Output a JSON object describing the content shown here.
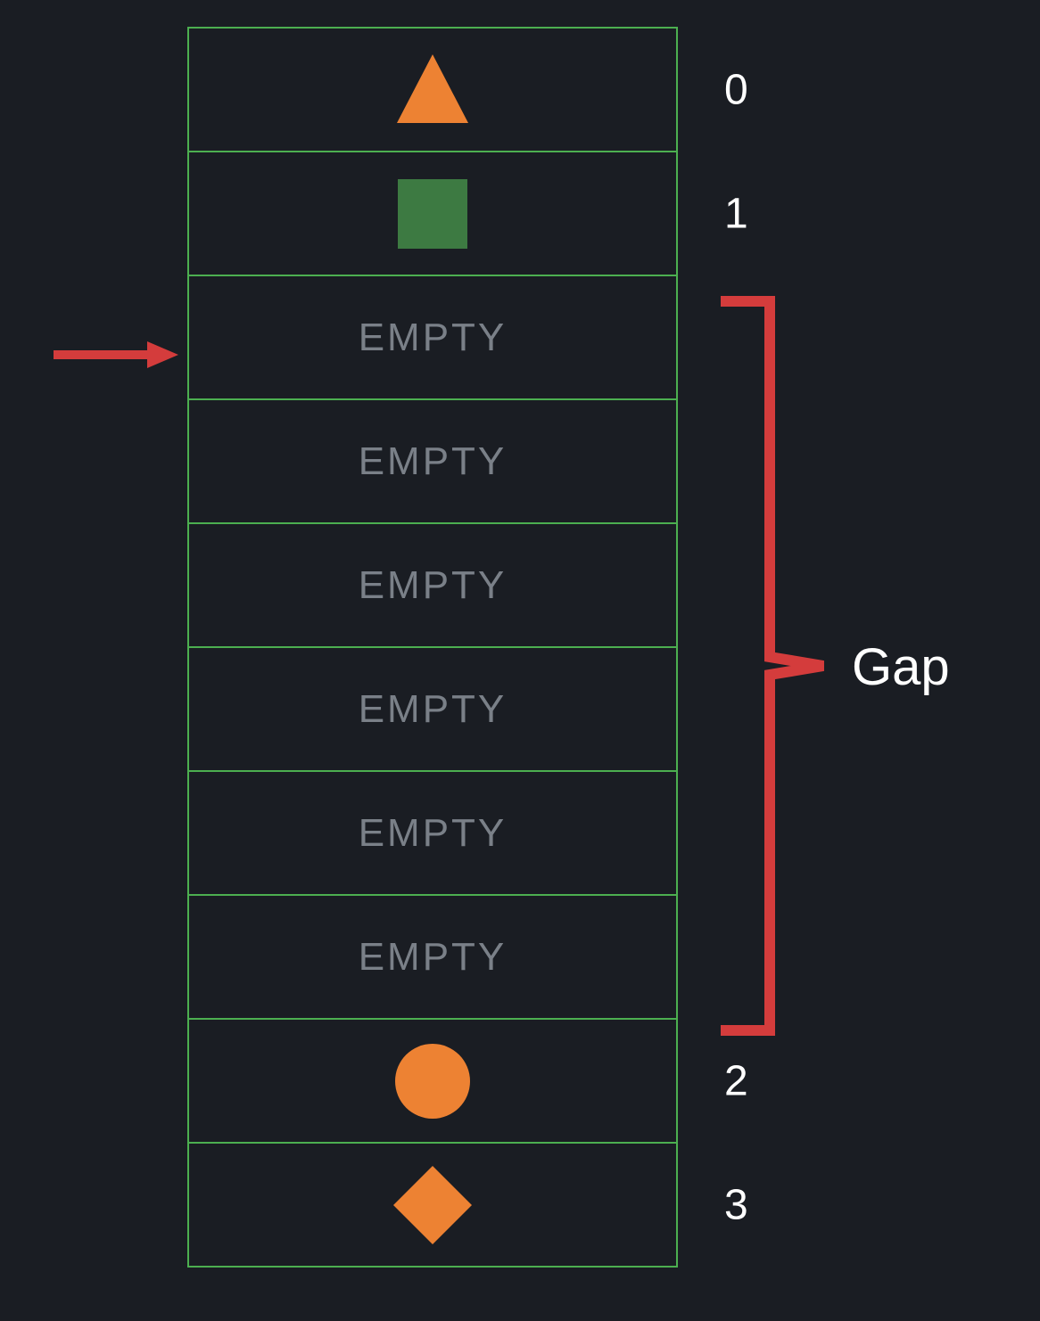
{
  "cells": [
    {
      "type": "shape",
      "shape": "triangle",
      "color": "#ed8233",
      "index": "0"
    },
    {
      "type": "shape",
      "shape": "square",
      "color": "#3d7a42",
      "index": "1"
    },
    {
      "type": "empty",
      "label": "EMPTY"
    },
    {
      "type": "empty",
      "label": "EMPTY"
    },
    {
      "type": "empty",
      "label": "EMPTY"
    },
    {
      "type": "empty",
      "label": "EMPTY"
    },
    {
      "type": "empty",
      "label": "EMPTY"
    },
    {
      "type": "empty",
      "label": "EMPTY"
    },
    {
      "type": "shape",
      "shape": "circle",
      "color": "#ed8233",
      "index": "2"
    },
    {
      "type": "shape",
      "shape": "diamond",
      "color": "#ed8233",
      "index": "3"
    }
  ],
  "gap_label": "Gap",
  "colors": {
    "border": "#4caf50",
    "arrow": "#d43c3c",
    "bracket": "#d43c3c",
    "empty_text": "#7a8088",
    "index_text": "#ffffff",
    "bg": "#1a1d23"
  }
}
